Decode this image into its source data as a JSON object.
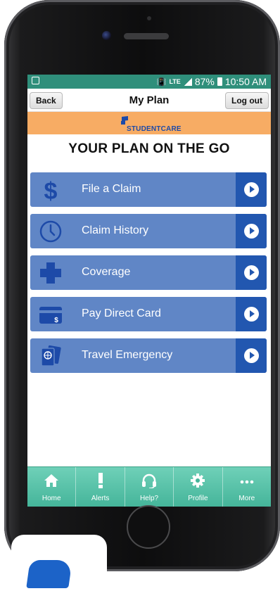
{
  "statusbar": {
    "battery_label": "87%",
    "time_label": "10:50 AM",
    "network_label": "LTE"
  },
  "navbar": {
    "back_label": "Back",
    "title": "My Plan",
    "logout_label": "Log out"
  },
  "brand": {
    "name": "STUDENTCARE"
  },
  "headline": "YOUR PLAN ON THE GO",
  "menu": {
    "items": [
      {
        "label": "File a Claim",
        "icon": "dollar-icon"
      },
      {
        "label": "Claim History",
        "icon": "clock-icon"
      },
      {
        "label": "Coverage",
        "icon": "plus-cross-icon"
      },
      {
        "label": "Pay Direct Card",
        "icon": "card-icon"
      },
      {
        "label": "Travel Emergency",
        "icon": "passport-icon"
      }
    ]
  },
  "tabbar": {
    "items": [
      {
        "label": "Home",
        "icon": "home-icon"
      },
      {
        "label": "Alerts",
        "icon": "exclamation-icon"
      },
      {
        "label": "Help?",
        "icon": "headset-icon"
      },
      {
        "label": "Profile",
        "icon": "gear-icon"
      },
      {
        "label": "More",
        "icon": "more-dots-icon"
      }
    ]
  },
  "colors": {
    "status_bar": "#2f8f7b",
    "brand_bar": "#f7ac64",
    "menu_item": "#6086c6",
    "menu_arrow": "#2257b0",
    "tab_bar": "#45b59a",
    "brand_text": "#1d4aa8"
  }
}
